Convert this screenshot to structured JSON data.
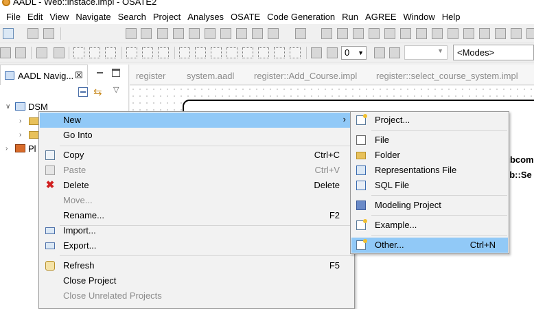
{
  "window": {
    "title": "AADL - Web::instace.impl - OSATE2"
  },
  "menubar": [
    "File",
    "Edit",
    "View",
    "Navigate",
    "Search",
    "Project",
    "Analyses",
    "OSATE",
    "Code Generation",
    "Run",
    "AGREE",
    "Window",
    "Help"
  ],
  "toolbar": {
    "zoom_value": "0",
    "modes_label": "<Modes>"
  },
  "navigator": {
    "tab_label": "AADL Navig...",
    "close_glyph": "☒",
    "tree": [
      {
        "label": "DSM",
        "expanded": true
      },
      {
        "label": "",
        "type": "folder"
      },
      {
        "label": "",
        "type": "folder"
      },
      {
        "label": "Pl",
        "type": "plugin"
      }
    ]
  },
  "editor_tabs": [
    "register",
    "system.aadl",
    "register::Add_Course.impl",
    "register::select_course_system.impl"
  ],
  "diagram": {
    "label1": "ubcom",
    "label2": "eb::Se"
  },
  "context_menu": {
    "items": [
      {
        "label": "New",
        "shortcut": "",
        "arrow": "›",
        "highlight": true
      },
      {
        "label": "Go Into",
        "shortcut": ""
      },
      {
        "label": "Copy",
        "shortcut": "Ctrl+C",
        "icon": "copy-icon"
      },
      {
        "label": "Paste",
        "shortcut": "Ctrl+V",
        "icon": "paste-icon",
        "disabled": true
      },
      {
        "label": "Delete",
        "shortcut": "Delete",
        "icon": "delete-icon"
      },
      {
        "label": "Move...",
        "shortcut": "",
        "disabled": true
      },
      {
        "label": "Rename...",
        "shortcut": "F2"
      },
      {
        "label": "Import...",
        "shortcut": "",
        "icon": "import-icon"
      },
      {
        "label": "Export...",
        "shortcut": "",
        "icon": "export-icon"
      },
      {
        "label": "Refresh",
        "shortcut": "F5",
        "icon": "refresh-icon"
      },
      {
        "label": "Close Project",
        "shortcut": ""
      },
      {
        "label": "Close Unrelated Projects",
        "shortcut": "",
        "disabled": true
      }
    ]
  },
  "submenu": {
    "items": [
      {
        "label": "Project...",
        "shortcut": "",
        "icon": "new-project-icon"
      },
      {
        "label": "File",
        "shortcut": "",
        "icon": "file-icon"
      },
      {
        "label": "Folder",
        "shortcut": "",
        "icon": "folder-icon"
      },
      {
        "label": "Representations File",
        "shortcut": "",
        "icon": "representations-file-icon"
      },
      {
        "label": "SQL File",
        "shortcut": "",
        "icon": "sql-file-icon"
      },
      {
        "label": "Modeling Project",
        "shortcut": "",
        "icon": "modeling-project-icon"
      },
      {
        "label": "Example...",
        "shortcut": "",
        "icon": "example-icon"
      },
      {
        "label": "Other...",
        "shortcut": "Ctrl+N",
        "icon": "other-wizard-icon",
        "highlight": true
      }
    ]
  },
  "colors": {
    "highlight": "#91c9f7",
    "menu_bg": "#f2f2f2",
    "disabled_text": "#8c8c8c"
  }
}
